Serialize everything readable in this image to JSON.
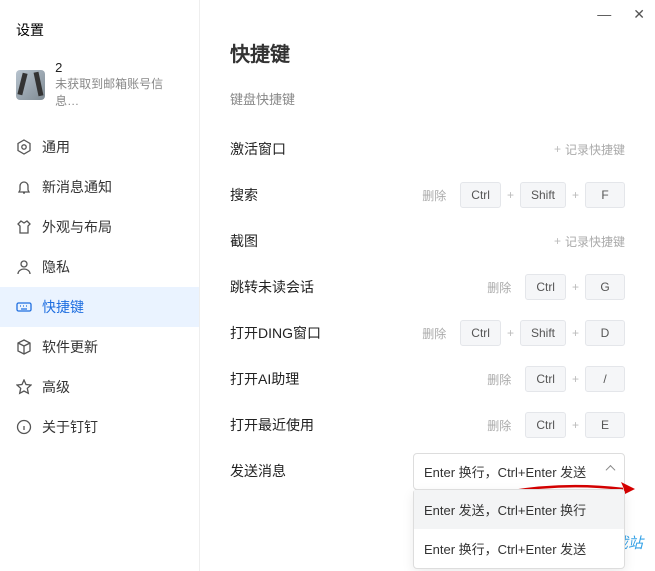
{
  "window": {
    "title": "设置",
    "minimize": "—",
    "close": "✕"
  },
  "user": {
    "name": "2",
    "sub": "未获取到邮箱账号信息…"
  },
  "sidebar": {
    "items": [
      {
        "label": "通用"
      },
      {
        "label": "新消息通知"
      },
      {
        "label": "外观与布局"
      },
      {
        "label": "隐私"
      },
      {
        "label": "快捷键"
      },
      {
        "label": "软件更新"
      },
      {
        "label": "高级"
      },
      {
        "label": "关于钉钉"
      }
    ]
  },
  "main": {
    "h1": "快捷键",
    "h2": "键盘快捷键",
    "record_label": "记录快捷键",
    "delete_label": "删除",
    "rows": {
      "activate": {
        "label": "激活窗口"
      },
      "search": {
        "label": "搜索",
        "keys": [
          "Ctrl",
          "Shift",
          "F"
        ]
      },
      "capture": {
        "label": "截图"
      },
      "jump": {
        "label": "跳转未读会话",
        "keys": [
          "Ctrl",
          "G"
        ]
      },
      "ding": {
        "label": "打开DING窗口",
        "keys": [
          "Ctrl",
          "Shift",
          "D"
        ]
      },
      "ai": {
        "label": "打开AI助理",
        "keys": [
          "Ctrl",
          "/"
        ]
      },
      "recent": {
        "label": "打开最近使用",
        "keys": [
          "Ctrl",
          "E"
        ]
      },
      "send": {
        "label": "发送消息"
      }
    },
    "dropdown": {
      "selected": "Enter 换行，Ctrl+Enter 发送",
      "options": [
        "Enter 发送，Ctrl+Enter 换行",
        "Enter 换行，Ctrl+Enter 发送"
      ]
    }
  },
  "watermark": "极光下载站"
}
